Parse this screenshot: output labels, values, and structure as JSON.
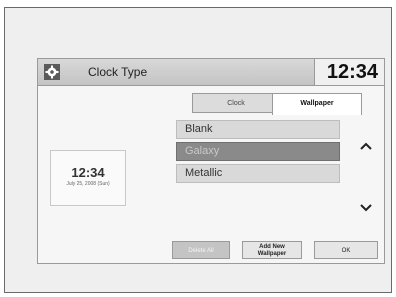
{
  "header": {
    "title": "Clock Type",
    "time": "12:34"
  },
  "preview": {
    "time": "12:34",
    "date": "July 25, 2008 (Sun)"
  },
  "tabs": [
    {
      "label": "Clock",
      "active": false
    },
    {
      "label": "Wallpaper",
      "active": true
    }
  ],
  "wallpaper_list": [
    {
      "label": "Blank",
      "selected": false
    },
    {
      "label": "Galaxy",
      "selected": true
    },
    {
      "label": "Metallic",
      "selected": false
    }
  ],
  "footer": {
    "delete_all": "Delete All",
    "add_new_line1": "Add New",
    "add_new_line2": "Wallpaper",
    "ok": "OK"
  },
  "icons": {
    "settings": "gear-icon",
    "scroll_up": "chevron-up-icon",
    "scroll_down": "chevron-down-icon"
  }
}
